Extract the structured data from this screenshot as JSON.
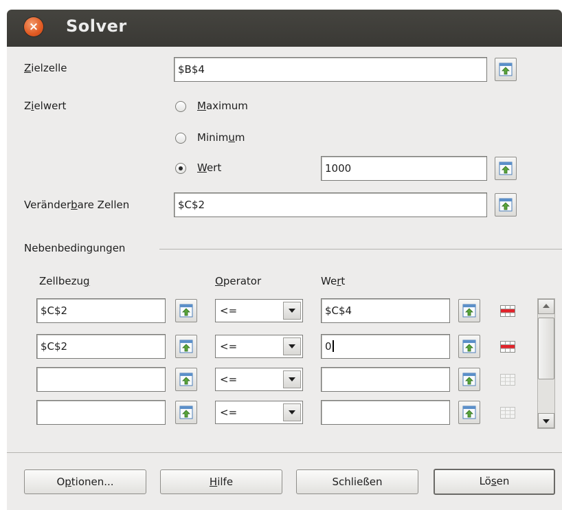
{
  "window": {
    "title": "Solver"
  },
  "target_cell": {
    "label": "Zielzelle",
    "value": "$B$4"
  },
  "optimize": {
    "label": "Zielwert",
    "options": [
      {
        "label": "Maximum",
        "selected": false
      },
      {
        "label": "Minimum",
        "selected": false
      },
      {
        "label": "Wert",
        "selected": true
      }
    ],
    "value": "1000"
  },
  "changing_cells": {
    "label": "Veränderbare Zellen",
    "value": "$C$2"
  },
  "constraints": {
    "section_label": "Nebenbedingungen",
    "headers": {
      "cell_ref": "Zellbezug",
      "operator": "Operator",
      "value": "Wert"
    },
    "rows": [
      {
        "cell_ref": "$C$2",
        "operator": "<=",
        "value": "$C$4",
        "remove_enabled": true
      },
      {
        "cell_ref": "$C$2",
        "operator": "<=",
        "value": "0",
        "remove_enabled": true
      },
      {
        "cell_ref": "",
        "operator": "<=",
        "value": "",
        "remove_enabled": false
      },
      {
        "cell_ref": "",
        "operator": "<=",
        "value": "",
        "remove_enabled": false
      }
    ]
  },
  "buttons": {
    "options": "Optionen...",
    "help": "Hilfe",
    "close": "Schließen",
    "solve": "Lösen"
  },
  "icons": {
    "close": "close-icon",
    "shrink": "shrink-icon",
    "remove": "remove-icon"
  },
  "colors": {
    "titlebar": "#3f3e3a",
    "close_button": "#e05a22",
    "panel": "#edeceb"
  }
}
